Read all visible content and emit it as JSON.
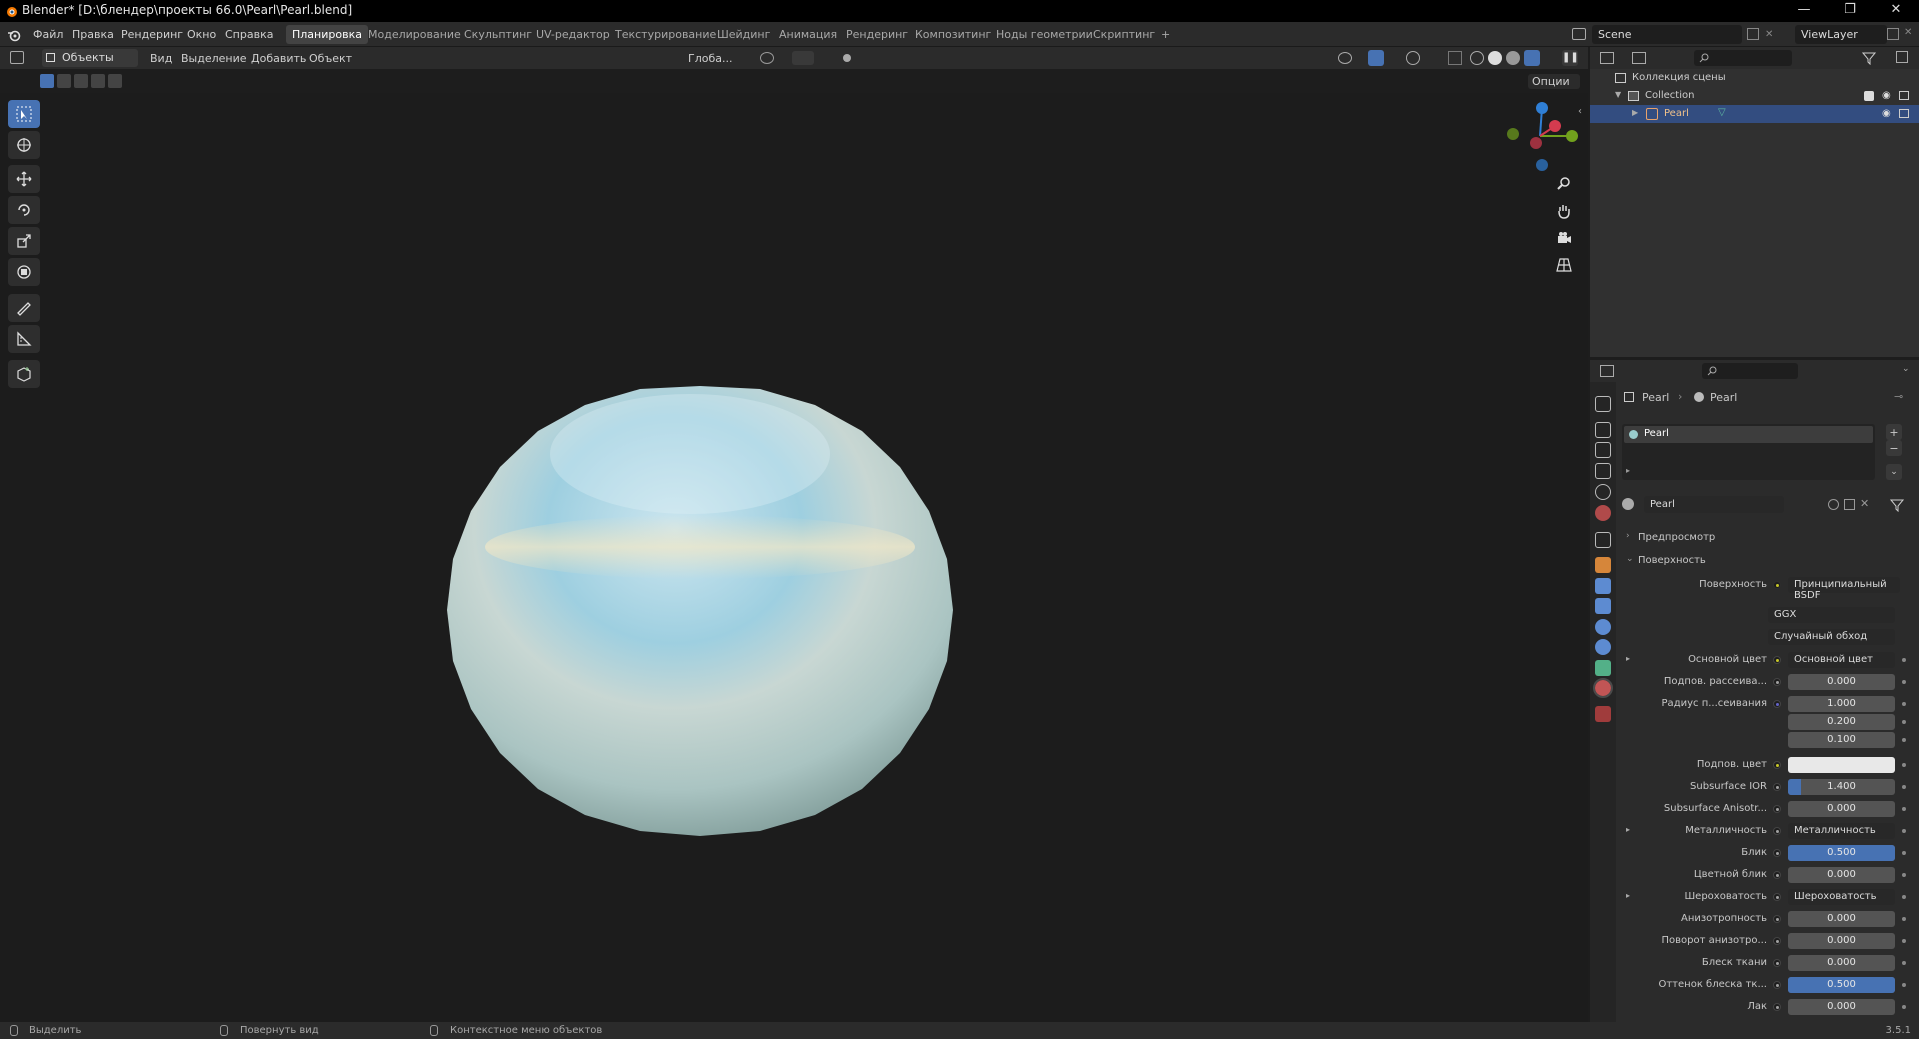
{
  "window": {
    "title": "Blender* [D:\\блендер\\проекты 66.0\\Pearl\\Pearl.blend]",
    "minimize": "—",
    "maximize": "❐",
    "close": "✕"
  },
  "menu": [
    "Файл",
    "Правка",
    "Рендеринг",
    "Окно",
    "Справка"
  ],
  "workspaces": [
    "Планировка",
    "Моделирование",
    "Скульптинг",
    "UV-редактор",
    "Текстурирование",
    "Шейдинг",
    "Анимация",
    "Рендеринг",
    "Композитинг",
    "Ноды геометрии",
    "Скриптинг",
    "+"
  ],
  "active_workspace": "Планировка",
  "scene": {
    "name": "Scene",
    "view_layer": "ViewLayer"
  },
  "viewport_header": {
    "mode": "Объекты",
    "menus": [
      "Вид",
      "Выделение",
      "Добавить",
      "Объект"
    ],
    "orientation": "Глоба...",
    "options": "Опции"
  },
  "outliner": {
    "scene_collection": "Коллекция сцены",
    "collection": "Collection",
    "object": "Pearl"
  },
  "properties": {
    "breadcrumb": [
      "Pearl",
      "Pearl"
    ],
    "material_slot": "Pearl",
    "material_name": "Pearl",
    "panels": {
      "preview": "Предпросмотр",
      "surface": "Поверхность"
    },
    "surface_label": "Поверхность",
    "surface_value": "Принципиальный BSDF",
    "distribution": "GGX",
    "subsurface_method": "Случайный обход",
    "rows": [
      {
        "label": "Основной цвет",
        "value": "Основной цвет",
        "kind": "link",
        "dot": "yellow",
        "expand": true
      },
      {
        "label": "Подпов. рассеива...",
        "value": "0.000",
        "kind": "num",
        "dot": "gray"
      },
      {
        "label": "Радиус п...сеивания",
        "value": "1.000",
        "kind": "num",
        "dot": "blue"
      },
      {
        "label": "",
        "value": "0.200",
        "kind": "num-sub"
      },
      {
        "label": "",
        "value": "0.100",
        "kind": "num-sub"
      },
      {
        "label": "Подпов. цвет",
        "value": "",
        "kind": "color",
        "dot": "yellow"
      },
      {
        "label": "Subsurface IOR",
        "value": "1.400",
        "kind": "slider",
        "dot": "gray",
        "fill": 0.12
      },
      {
        "label": "Subsurface Anisotr...",
        "value": "0.000",
        "kind": "num",
        "dot": "gray"
      },
      {
        "label": "Металличность",
        "value": "Металличность",
        "kind": "link",
        "dot": "gray",
        "expand": true
      },
      {
        "label": "Блик",
        "value": "0.500",
        "kind": "slider",
        "dot": "gray",
        "fill": 1.0
      },
      {
        "label": "Цветной блик",
        "value": "0.000",
        "kind": "num",
        "dot": "gray"
      },
      {
        "label": "Шероховатость",
        "value": "Шероховатость",
        "kind": "link",
        "dot": "gray",
        "expand": true
      },
      {
        "label": "Анизотропность",
        "value": "0.000",
        "kind": "num",
        "dot": "gray"
      },
      {
        "label": "Поворот анизотро...",
        "value": "0.000",
        "kind": "num",
        "dot": "gray"
      },
      {
        "label": "Блеск ткани",
        "value": "0.000",
        "kind": "num",
        "dot": "gray"
      },
      {
        "label": "Оттенок блеска тк...",
        "value": "0.500",
        "kind": "slider",
        "dot": "gray",
        "fill": 1.0
      },
      {
        "label": "Лак",
        "value": "0.000",
        "kind": "num",
        "dot": "gray"
      }
    ]
  },
  "statusbar": {
    "select": "Выделить",
    "rotate": "Повернуть вид",
    "context": "Контекстное меню объектов",
    "version": "3.5.1"
  },
  "colors": {
    "accent": "#4772b3",
    "selected_row": "#334d80",
    "header": "#2b2b2b",
    "panel": "#303030"
  }
}
